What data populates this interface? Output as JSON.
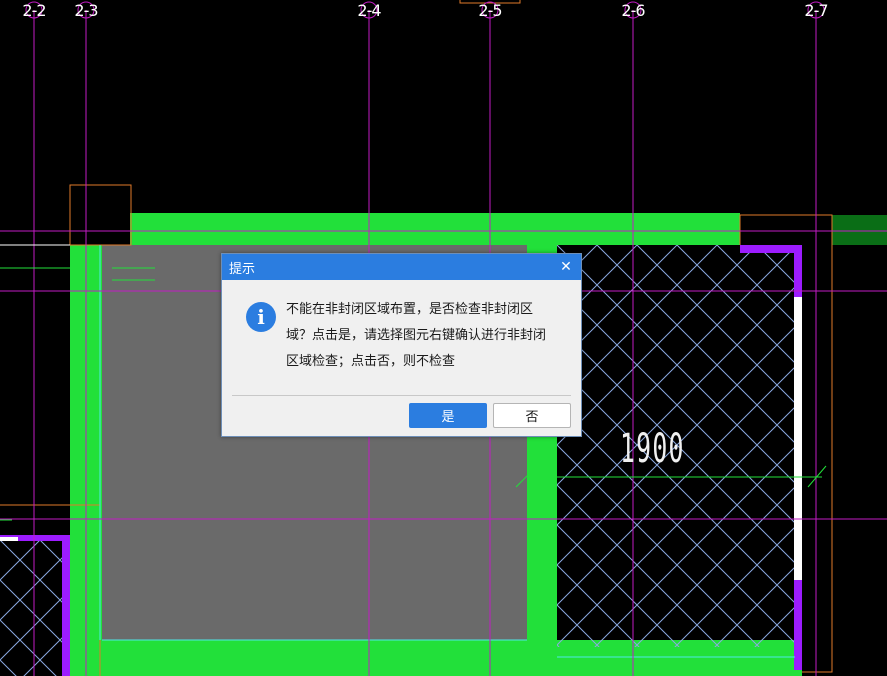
{
  "grid_labels": [
    "2-2",
    "2-3",
    "2-4",
    "2-5",
    "2-6",
    "2-7"
  ],
  "dimension_text": "1900",
  "dialog": {
    "title": "提示",
    "close_glyph": "✕",
    "icon_glyph": "i",
    "message": "不能在非封闭区域布置，是否检查非封闭区域？点击是，请选择图元右键确认进行非封闭区域检查；点击否，则不检查",
    "yes_label": "是",
    "no_label": "否"
  },
  "colors": {
    "wall_green": "#22e03a",
    "slab_gray": "#6a6a6a",
    "grid_magenta": "#c21cc4",
    "hatch_blue": "#8aa8e0",
    "outline_orange": "#e07a2a",
    "purple_edge": "#9c1cff",
    "dialog_accent": "#2b7de0"
  }
}
